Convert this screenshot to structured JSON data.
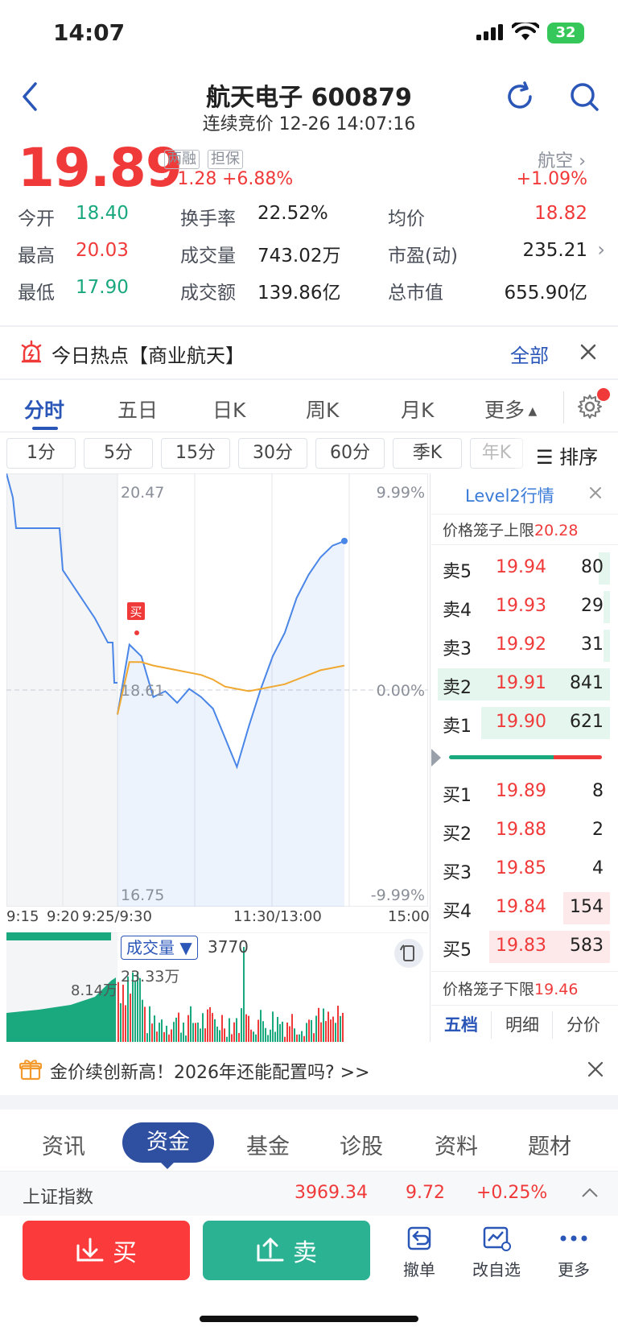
{
  "status": {
    "time": "14:07",
    "battery": "32"
  },
  "header": {
    "title": "航天电子 600879",
    "subtitle": "连续竞价 12-26 14:07:16"
  },
  "quote": {
    "price": "19.89",
    "tags": [
      "两融",
      "担保"
    ],
    "change": "+1.28",
    "change_pct": "+6.88%",
    "sector": "航空",
    "sector_pct": "+1.09%",
    "stats": [
      {
        "label": "今开",
        "value": "18.40",
        "color": "#1aa87f"
      },
      {
        "label": "换手率",
        "value": "22.52%",
        "color": "#222222"
      },
      {
        "label": "均价",
        "value": "18.82",
        "color": "#f03a3a"
      },
      {
        "label": "最高",
        "value": "20.03",
        "color": "#f03a3a"
      },
      {
        "label": "成交量",
        "value": "743.02万",
        "color": "#222222"
      },
      {
        "label": "市盈(动)",
        "value": "235.21",
        "color": "#222222"
      },
      {
        "label": "最低",
        "value": "17.90",
        "color": "#1aa87f"
      },
      {
        "label": "成交额",
        "value": "139.86亿",
        "color": "#222222"
      },
      {
        "label": "总市值",
        "value": "655.90亿",
        "color": "#222222"
      }
    ]
  },
  "hot": {
    "text": "今日热点【商业航天】",
    "all": "全部"
  },
  "tabs": [
    "分时",
    "五日",
    "日K",
    "周K",
    "月K",
    "更多"
  ],
  "periods": [
    "1分",
    "5分",
    "15分",
    "30分",
    "60分",
    "季K",
    "年K"
  ],
  "sort_label": "排序",
  "chart": {
    "top_price": "20.47",
    "mid_price": "18.61",
    "bottom_price": "16.75",
    "top_pct": "9.99%",
    "mid_pct": "0.00%",
    "bottom_pct": "-9.99%",
    "buy_marker": "买",
    "time_labels": [
      "9:15",
      "9:20",
      "9:25/9:30",
      "11:30/13:00",
      "15:00"
    ],
    "volume_label": "成交量",
    "volume_value": "3770",
    "vol_max": "23.33万",
    "vol_auction": "8.14万"
  },
  "chart_data": {
    "type": "line",
    "x": [
      "9:30",
      "9:40",
      "9:50",
      "10:00",
      "10:10",
      "10:20",
      "10:30",
      "10:40",
      "10:50",
      "11:00",
      "11:10",
      "11:20",
      "11:30",
      "13:10",
      "13:20",
      "13:30",
      "13:40",
      "13:50",
      "14:00",
      "14:07"
    ],
    "series": [
      {
        "values": [
          18.4,
          19.0,
          18.9,
          18.55,
          18.6,
          18.5,
          18.62,
          18.55,
          18.45,
          18.2,
          17.95,
          18.3,
          18.62,
          18.9,
          19.1,
          19.4,
          19.6,
          19.75,
          19.85,
          19.89
        ]
      },
      {
        "values": [
          18.4,
          18.85,
          18.85,
          18.82,
          18.8,
          18.78,
          18.76,
          18.74,
          18.7,
          18.64,
          18.62,
          18.6,
          18.62,
          18.64,
          18.66,
          18.7,
          18.74,
          18.78,
          18.8,
          18.82
        ]
      }
    ],
    "ylim": [
      16.75,
      20.47
    ]
  },
  "orderbook": {
    "title": "Level2行情",
    "upper_limit_label": "价格笼子上限",
    "upper_limit": "20.28",
    "lower_limit_label": "价格笼子下限",
    "lower_limit": "19.46",
    "asks": [
      {
        "label": "卖5",
        "price": "19.94",
        "qty": "80"
      },
      {
        "label": "卖4",
        "price": "19.93",
        "qty": "29"
      },
      {
        "label": "卖3",
        "price": "19.92",
        "qty": "31"
      },
      {
        "label": "卖2",
        "price": "19.91",
        "qty": "841"
      },
      {
        "label": "卖1",
        "price": "19.90",
        "qty": "621"
      }
    ],
    "bids": [
      {
        "label": "买1",
        "price": "19.89",
        "qty": "8"
      },
      {
        "label": "买2",
        "price": "19.88",
        "qty": "2"
      },
      {
        "label": "买3",
        "price": "19.85",
        "qty": "4"
      },
      {
        "label": "买4",
        "price": "19.84",
        "qty": "154"
      },
      {
        "label": "买5",
        "price": "19.83",
        "qty": "583"
      }
    ],
    "tabs": [
      "五档",
      "明细",
      "分价"
    ]
  },
  "banner": {
    "text": "金价续创新高！2026年还能配置吗? >>"
  },
  "bottom_tabs": [
    "资讯",
    "资金",
    "基金",
    "诊股",
    "资料",
    "题材"
  ],
  "index": {
    "name": "上证指数",
    "value": "3969.34",
    "change": "9.72",
    "pct": "+0.25%"
  },
  "actions": {
    "buy": "买",
    "sell": "卖",
    "cancel": "撤单",
    "watch": "改自选",
    "more": "更多"
  }
}
